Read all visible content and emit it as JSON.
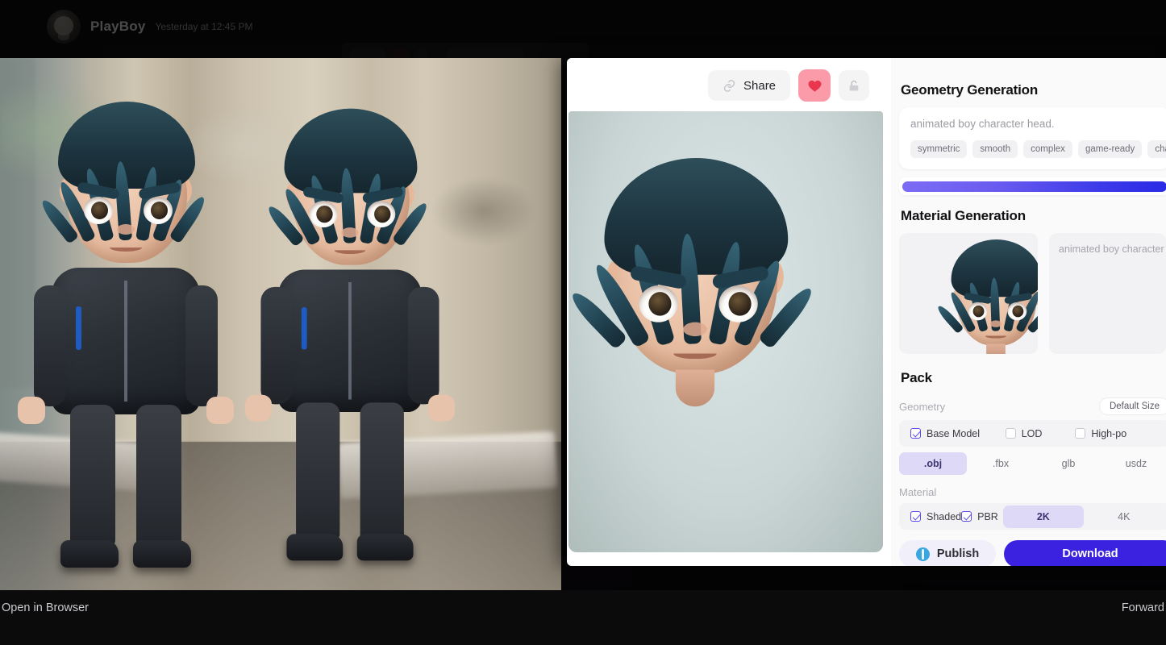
{
  "background": {
    "message": {
      "author": "PlayBoy",
      "timestamp": "Yesterday at 12:45 PM"
    }
  },
  "app": {
    "toolbar": {
      "share_label": "Share",
      "share_icon": "link-icon",
      "favorite_icon": "heart-icon",
      "lock_icon": "unlock-icon"
    },
    "geometry_generation": {
      "title": "Geometry Generation",
      "prompt": "animated boy character head.",
      "tags": [
        "symmetric",
        "smooth",
        "complex",
        "game-ready",
        "character"
      ],
      "progress_percent": 100
    },
    "material_generation": {
      "title": "Material Generation",
      "prompt": "animated boy character hea"
    },
    "pack": {
      "title": "Pack",
      "geometry": {
        "label": "Geometry",
        "size_button": "Default Size",
        "options": [
          {
            "label": "Base Model",
            "checked": true
          },
          {
            "label": "LOD",
            "checked": false
          },
          {
            "label": "High-po",
            "checked": false
          }
        ],
        "formats": [
          {
            "label": ".obj",
            "active": true
          },
          {
            "label": ".fbx",
            "active": false
          },
          {
            "label": "glb",
            "active": false
          },
          {
            "label": "usdz",
            "active": false
          }
        ]
      },
      "material": {
        "label": "Material",
        "options": [
          {
            "label": "Shaded",
            "checked": true
          },
          {
            "label": "PBR",
            "checked": true
          }
        ],
        "resolutions": [
          {
            "label": "2K",
            "active": true
          },
          {
            "label": "4K",
            "active": false
          }
        ]
      }
    },
    "actions": {
      "publish_label": "Publish",
      "publish_icon": "globe-icon",
      "download_label": "Download"
    }
  },
  "bottom_bar": {
    "open_in_browser": "Open in Browser",
    "forward": "Forward"
  },
  "colors": {
    "accent": "#3b22e0",
    "progress_start": "#7c6cf5",
    "progress_end": "#2b2ae6",
    "favorite": "#fb9aa8",
    "segment_active_bg": "#ddd9f7"
  }
}
